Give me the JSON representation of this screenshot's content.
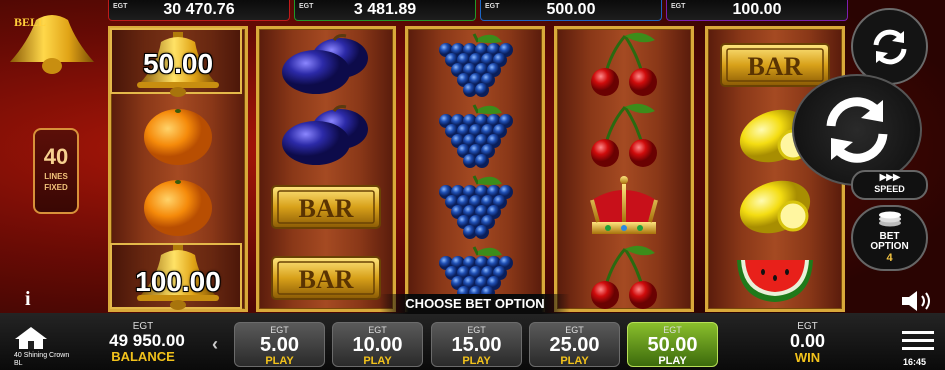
{
  "jackpots": [
    {
      "currency": "EGT",
      "value": "30 470.76",
      "color": "red"
    },
    {
      "currency": "EGT",
      "value": "3 481.89",
      "color": "green"
    },
    {
      "currency": "EGT",
      "value": "500.00",
      "color": "blue"
    },
    {
      "currency": "EGT",
      "value": "100.00",
      "color": "purple"
    }
  ],
  "lines": {
    "count": "40",
    "label_line1": "LINES",
    "label_line2": "FIXED"
  },
  "reels": [
    [
      "bell",
      "orange",
      "orange",
      "bell"
    ],
    [
      "plum",
      "plum",
      "bar",
      "bar"
    ],
    [
      "grapes",
      "grapes",
      "grapes",
      "grapes"
    ],
    [
      "cherries",
      "cherries",
      "crown",
      "cherries"
    ],
    [
      "bar",
      "lemon",
      "lemon",
      "watermelon"
    ]
  ],
  "win_amounts": {
    "top": "50.00",
    "bottom": "100.00"
  },
  "controls": {
    "speed_label": "SPEED",
    "speed_arrows": "▶▶▶",
    "bet_option_label_1": "BET",
    "bet_option_label_2": "OPTION",
    "bet_option_value": "4"
  },
  "choose_bet_option": "CHOOSE BET OPTION",
  "footer": {
    "game_name_1": "40 Shining Crown",
    "game_name_2": "BL",
    "balance_currency": "EGT",
    "balance_value": "49 950.00",
    "balance_label": "BALANCE",
    "win_currency": "EGT",
    "win_value": "0.00",
    "win_label": "WIN",
    "time": "16:45"
  },
  "bets": [
    {
      "currency": "EGT",
      "amount": "5.00",
      "label": "PLAY",
      "active": false
    },
    {
      "currency": "EGT",
      "amount": "10.00",
      "label": "PLAY",
      "active": false
    },
    {
      "currency": "EGT",
      "amount": "15.00",
      "label": "PLAY",
      "active": false
    },
    {
      "currency": "EGT",
      "amount": "25.00",
      "label": "PLAY",
      "active": false
    },
    {
      "currency": "EGT",
      "amount": "50.00",
      "label": "PLAY",
      "active": true
    }
  ]
}
